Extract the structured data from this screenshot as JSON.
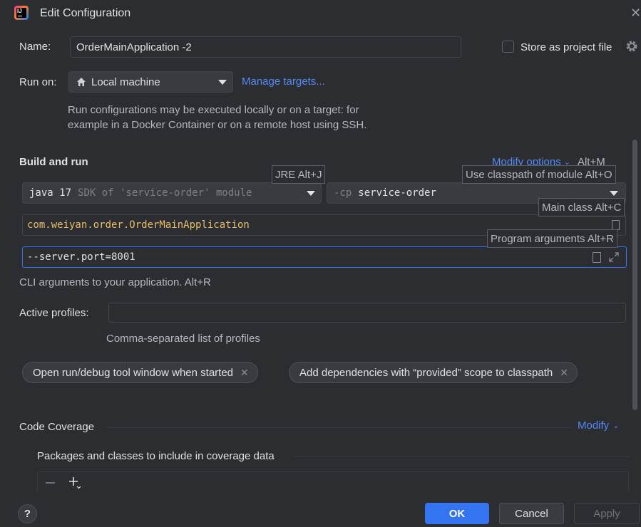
{
  "window": {
    "title": "Edit Configuration",
    "icon": "intellij-idea-logo-icon"
  },
  "name_row": {
    "label": "Name:",
    "value": "OrderMainApplication -2",
    "store_label": "Store as project file",
    "store_checked": false
  },
  "run_on": {
    "label": "Run on:",
    "value": "Local machine",
    "manage_targets": "Manage targets...",
    "description_line1": "Run configurations may be executed locally or on a target: for",
    "description_line2": "example in a Docker Container or on a remote host using SSH."
  },
  "build": {
    "title": "Build and run",
    "modify_options": "Modify options",
    "modify_shortcut": "Alt+M",
    "jre": {
      "version": "java 17",
      "hint": "SDK of 'service-order' module"
    },
    "classpath": {
      "prefix": "-cp",
      "value": "service-order"
    },
    "main_class": "com.weiyan.order.OrderMainApplication",
    "program_args": "--server.port=8001",
    "args_hint": "CLI arguments to your application. Alt+R"
  },
  "tooltips": {
    "jre": "JRE Alt+J",
    "classpath": "Use classpath of module Alt+O",
    "main_class": "Main class Alt+C",
    "program_args": "Program arguments Alt+R"
  },
  "profiles": {
    "label": "Active profiles:",
    "value": "",
    "hint": "Comma-separated list of profiles"
  },
  "tags": [
    {
      "label": "Open run/debug tool window when started"
    },
    {
      "label": "Add dependencies with “provided” scope to classpath"
    }
  ],
  "coverage": {
    "title": "Code Coverage",
    "modify": "Modify",
    "packages_label": "Packages and classes to include in coverage data"
  },
  "footer": {
    "help": "?",
    "ok": "OK",
    "cancel": "Cancel",
    "apply": "Apply"
  },
  "colors": {
    "accent": "#548af7",
    "ok_button": "#3574f0",
    "main_class_text": "#e8bf6a",
    "background": "#2b2d30"
  }
}
